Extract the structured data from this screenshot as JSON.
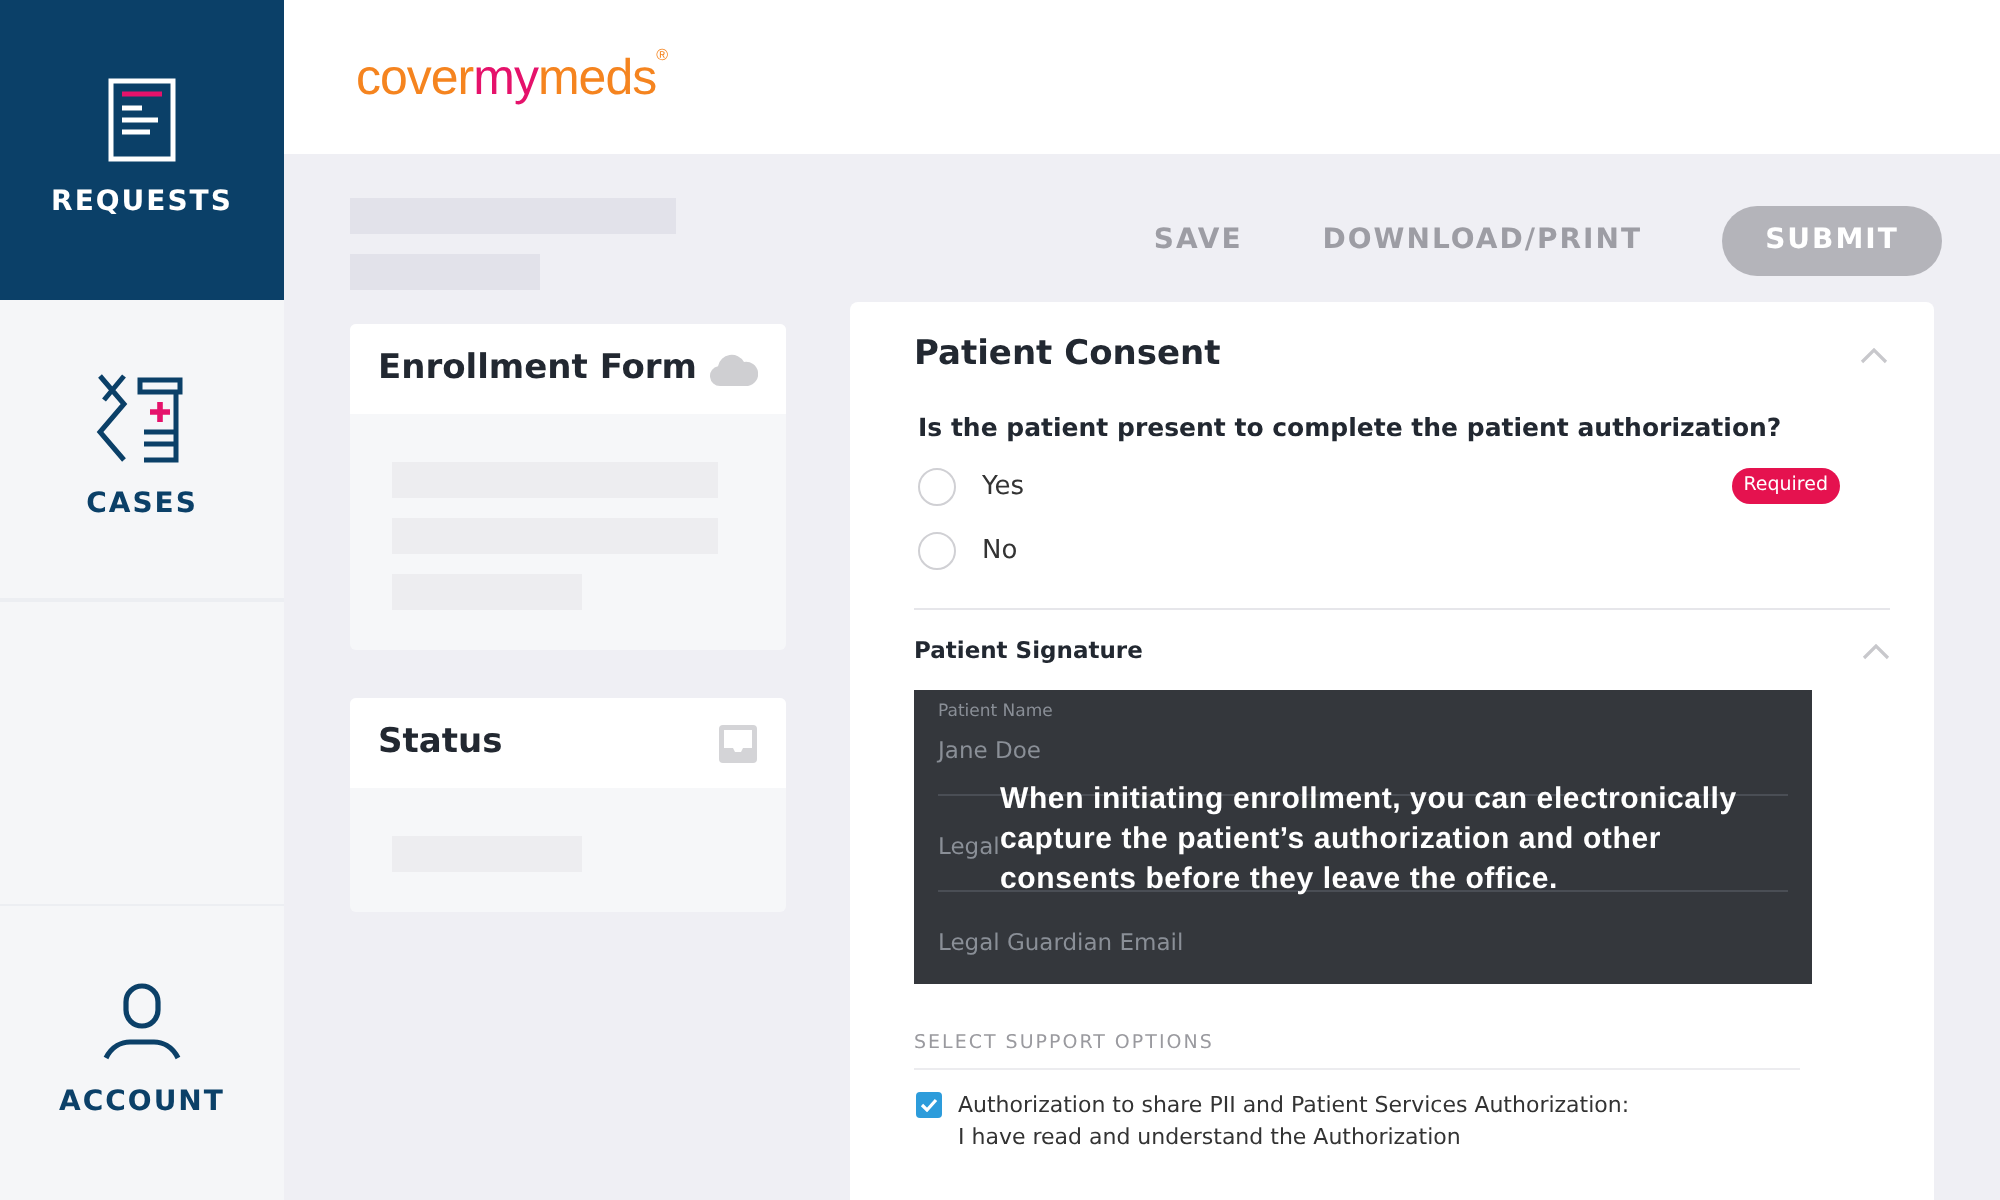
{
  "sidebar": {
    "items": [
      {
        "label": "REQUESTS",
        "kind": "requests",
        "selected": true
      },
      {
        "label": "CASES",
        "kind": "cases",
        "selected": false
      },
      {
        "label": "ACCOUNT",
        "kind": "account",
        "selected": false
      }
    ]
  },
  "header": {
    "logo": [
      {
        "text": "cover",
        "color": "#f5841f"
      },
      {
        "text": "my",
        "color": "#e5126b"
      },
      {
        "text": "meds",
        "color": "#f5841f"
      }
    ],
    "logo_mark": "®"
  },
  "toolbar": {
    "buttons": [
      {
        "label": "SAVE",
        "kind": "text"
      },
      {
        "label": "DOWNLOAD/PRINT",
        "kind": "text"
      },
      {
        "label": "SUBMIT",
        "kind": "pill",
        "disabled": true
      }
    ]
  },
  "cards": [
    {
      "title": "Enrollment Form"
    },
    {
      "title": "Status"
    }
  ],
  "consent": {
    "title": "Patient Consent",
    "expanded": true,
    "question": "Is the patient present to complete the patient authorization?",
    "options": [
      {
        "label": "Yes",
        "selected": false
      },
      {
        "label": "No",
        "selected": false
      }
    ],
    "badge": "Required",
    "signature": {
      "title": "Patient Signature",
      "expanded": true,
      "fields": [
        {
          "label": "Patient Name",
          "value": "Jane Doe"
        },
        {
          "placeholder": "Legal"
        },
        {
          "placeholder": "Legal Guardian Email"
        }
      ]
    },
    "tooltip": "When initiating enrollment, you can electronically capture the patient’s authorization and other consents before they leave the office.",
    "support_heading": "SELECT SUPPORT OPTIONS",
    "support_options": [
      {
        "lines": [
          "Authorization to share PII and Patient Services Authorization:",
          "I have read and understand the Authorization"
        ],
        "checked": true
      }
    ]
  }
}
